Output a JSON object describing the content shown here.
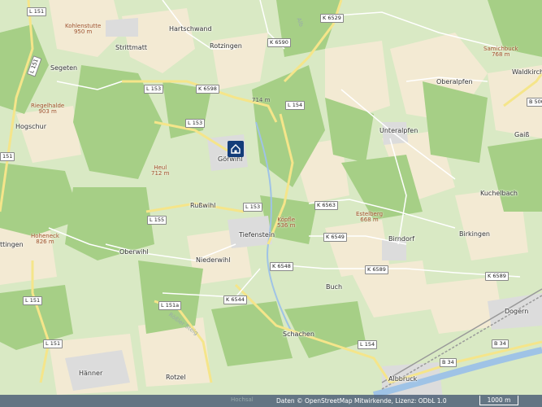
{
  "places": {
    "hartschwand": "Hartschwand",
    "rotzingen": "Rotzingen",
    "strittmatt": "Strittmatt",
    "segeten": "Segeten",
    "hogschur": "Hogschur",
    "goerwihl": "Görwihl",
    "russwihl": "Rußwihl",
    "tiefenstein": "Tiefenstein",
    "oberwihl": "Oberwihl",
    "niederwihl": "Niederwihl",
    "buch": "Buch",
    "birndorf": "Birndorf",
    "birkingen": "Birkingen",
    "kuchelbach": "Kuchelbach",
    "unteralpfen": "Unteralpfen",
    "oberalpfen": "Oberalpfen",
    "waldkirch": "Waldkirch",
    "gaiss": "Gaiß",
    "schachen": "Schachen",
    "rotzel": "Rotzel",
    "haenner": "Hänner",
    "dogern": "Dogern",
    "albbruck": "Albbruck",
    "ttingen": "ttingen",
    "hochsal": "Hochsal"
  },
  "peaks": {
    "kohlenstutte": "Kohlenstutte\n950 m",
    "riegelhalde": "Riegelhalde\n903 m",
    "heul": "Heul\n712 m",
    "hoheneck": "Hoheneck\n826 m",
    "kopfle": "Köpfle\n536 m",
    "estelberg": "Estelberg\n668 m",
    "samichbuck": "Samichbuck\n768 m",
    "spot_714": "714 m"
  },
  "roads": {
    "l151_a": "L 151",
    "l151_b": "L 151",
    "l151_c": "L 151",
    "l151_d": "L 151",
    "l151_e": "151",
    "l151a": "L 151a",
    "l153_a": "L 153",
    "l153_b": "L 153",
    "l153_c": "L 153",
    "l154_a": "L 154",
    "l154_b": "L 154",
    "l155": "L 155",
    "k6529": "K 6529",
    "k6590": "K 6590",
    "k6598": "K 6598",
    "k6563": "K 6563",
    "k6549": "K 6549",
    "k6548": "K 6548",
    "k6589_a": "K 6589",
    "k6589_b": "K 6589",
    "k6544": "K 6544",
    "b34_a": "B 34",
    "b34_b": "B 34",
    "b500": "B 500",
    "alb": "Alb",
    "roesslersteig": "Rößler Steig"
  },
  "attribution": {
    "text": "Daten © OpenStreetMap Mitwirkende, Lizenz: ODbL 1.0",
    "scale": "1000 m"
  },
  "colors": {
    "forest": "#a6cf86",
    "meadow": "#d9e9c4",
    "farmland": "#f3ead3",
    "settlement": "#dedede",
    "road_major": "#f5e58a",
    "water": "#9fc3e6",
    "marker": "#133c79"
  }
}
